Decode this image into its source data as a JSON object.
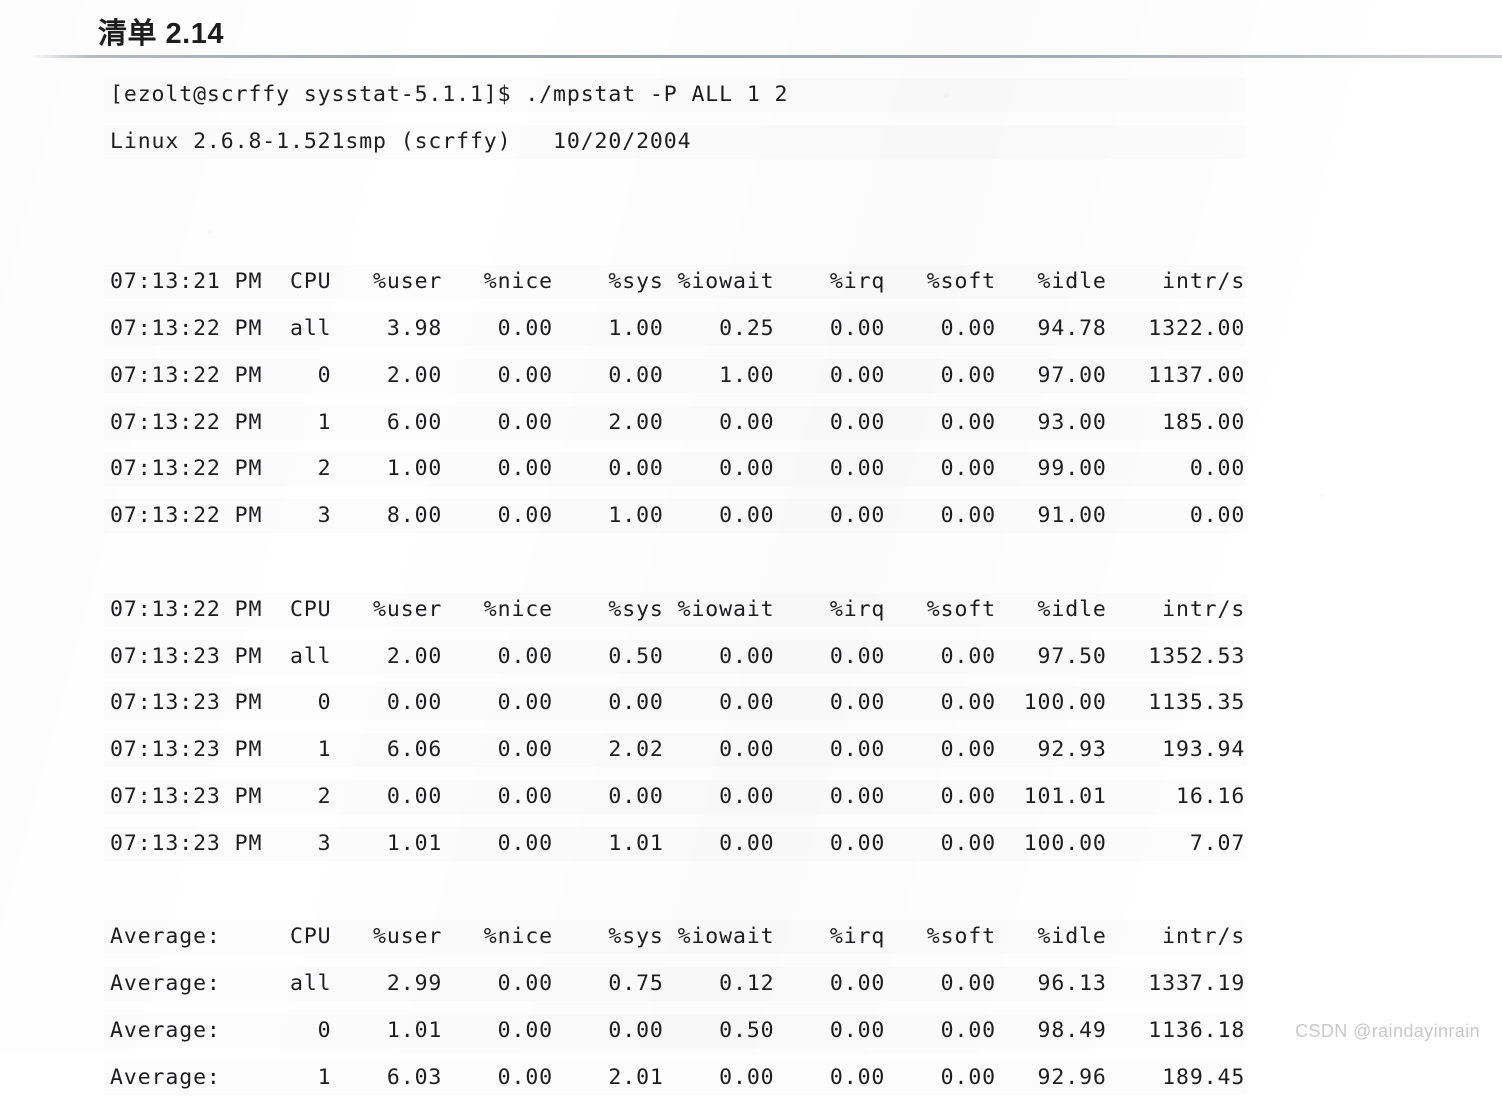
{
  "title": "清单 2.14",
  "watermark": "CSDN @raindayinrain",
  "terminal": {
    "prompt_line": "[ezolt@scrffy sysstat-5.1.1]$ ./mpstat -P ALL 1 2",
    "version_line": "Linux 2.6.8-1.521smp (scrffy)   10/20/2004",
    "columns": [
      "",
      "CPU",
      "%user",
      "%nice",
      "%sys",
      "%iowait",
      "%irq",
      "%soft",
      "%idle",
      "intr/s"
    ],
    "blocks": [
      {
        "header": [
          "07:13:21 PM",
          "CPU",
          "%user",
          "%nice",
          "%sys",
          "%iowait",
          "%irq",
          "%soft",
          "%idle",
          "intr/s"
        ],
        "rows": [
          [
            "07:13:22 PM",
            "all",
            "3.98",
            "0.00",
            "1.00",
            "0.25",
            "0.00",
            "0.00",
            "94.78",
            "1322.00"
          ],
          [
            "07:13:22 PM",
            "0",
            "2.00",
            "0.00",
            "0.00",
            "1.00",
            "0.00",
            "0.00",
            "97.00",
            "1137.00"
          ],
          [
            "07:13:22 PM",
            "1",
            "6.00",
            "0.00",
            "2.00",
            "0.00",
            "0.00",
            "0.00",
            "93.00",
            "185.00"
          ],
          [
            "07:13:22 PM",
            "2",
            "1.00",
            "0.00",
            "0.00",
            "0.00",
            "0.00",
            "0.00",
            "99.00",
            "0.00"
          ],
          [
            "07:13:22 PM",
            "3",
            "8.00",
            "0.00",
            "1.00",
            "0.00",
            "0.00",
            "0.00",
            "91.00",
            "0.00"
          ]
        ]
      },
      {
        "header": [
          "07:13:22 PM",
          "CPU",
          "%user",
          "%nice",
          "%sys",
          "%iowait",
          "%irq",
          "%soft",
          "%idle",
          "intr/s"
        ],
        "rows": [
          [
            "07:13:23 PM",
            "all",
            "2.00",
            "0.00",
            "0.50",
            "0.00",
            "0.00",
            "0.00",
            "97.50",
            "1352.53"
          ],
          [
            "07:13:23 PM",
            "0",
            "0.00",
            "0.00",
            "0.00",
            "0.00",
            "0.00",
            "0.00",
            "100.00",
            "1135.35"
          ],
          [
            "07:13:23 PM",
            "1",
            "6.06",
            "0.00",
            "2.02",
            "0.00",
            "0.00",
            "0.00",
            "92.93",
            "193.94"
          ],
          [
            "07:13:23 PM",
            "2",
            "0.00",
            "0.00",
            "0.00",
            "0.00",
            "0.00",
            "0.00",
            "101.01",
            "16.16"
          ],
          [
            "07:13:23 PM",
            "3",
            "1.01",
            "0.00",
            "1.01",
            "0.00",
            "0.00",
            "0.00",
            "100.00",
            "7.07"
          ]
        ]
      },
      {
        "header": [
          "Average:",
          "CPU",
          "%user",
          "%nice",
          "%sys",
          "%iowait",
          "%irq",
          "%soft",
          "%idle",
          "intr/s"
        ],
        "rows": [
          [
            "Average:",
            "all",
            "2.99",
            "0.00",
            "0.75",
            "0.12",
            "0.00",
            "0.00",
            "96.13",
            "1337.19"
          ],
          [
            "Average:",
            "0",
            "1.01",
            "0.00",
            "0.00",
            "0.50",
            "0.00",
            "0.00",
            "98.49",
            "1136.18"
          ],
          [
            "Average:",
            "1",
            "6.03",
            "0.00",
            "2.01",
            "0.00",
            "0.00",
            "0.00",
            "92.96",
            "189.45"
          ]
        ]
      }
    ]
  },
  "lines": [
    "[ezolt@scrffy sysstat-5.1.1]$ ./mpstat -P ALL 1 2",
    "Linux 2.6.8-1.521smp (scrffy)   10/20/2004",
    "",
    "",
    "07:13:21 PM  CPU   %user   %nice    %sys %iowait    %irq   %soft   %idle    intr/s",
    "07:13:22 PM  all    3.98    0.00    1.00    0.25    0.00    0.00   94.78   1322.00",
    "07:13:22 PM    0    2.00    0.00    0.00    1.00    0.00    0.00   97.00   1137.00",
    "07:13:22 PM    1    6.00    0.00    2.00    0.00    0.00    0.00   93.00    185.00",
    "07:13:22 PM    2    1.00    0.00    0.00    0.00    0.00    0.00   99.00      0.00",
    "07:13:22 PM    3    8.00    0.00    1.00    0.00    0.00    0.00   91.00      0.00",
    "",
    "07:13:22 PM  CPU   %user   %nice    %sys %iowait    %irq   %soft   %idle    intr/s",
    "07:13:23 PM  all    2.00    0.00    0.50    0.00    0.00    0.00   97.50   1352.53",
    "07:13:23 PM    0    0.00    0.00    0.00    0.00    0.00    0.00  100.00   1135.35",
    "07:13:23 PM    1    6.06    0.00    2.02    0.00    0.00    0.00   92.93    193.94",
    "07:13:23 PM    2    0.00    0.00    0.00    0.00    0.00    0.00  101.01     16.16",
    "07:13:23 PM    3    1.01    0.00    1.01    0.00    0.00    0.00  100.00      7.07",
    "",
    "Average:     CPU   %user   %nice    %sys %iowait    %irq   %soft   %idle    intr/s",
    "Average:     all    2.99    0.00    0.75    0.12    0.00    0.00   96.13   1337.19",
    "Average:       0    1.01    0.00    0.00    0.50    0.00    0.00   98.49   1136.18",
    "Average:       1    6.03    0.00    2.01    0.00    0.00    0.00   92.96    189.45"
  ]
}
